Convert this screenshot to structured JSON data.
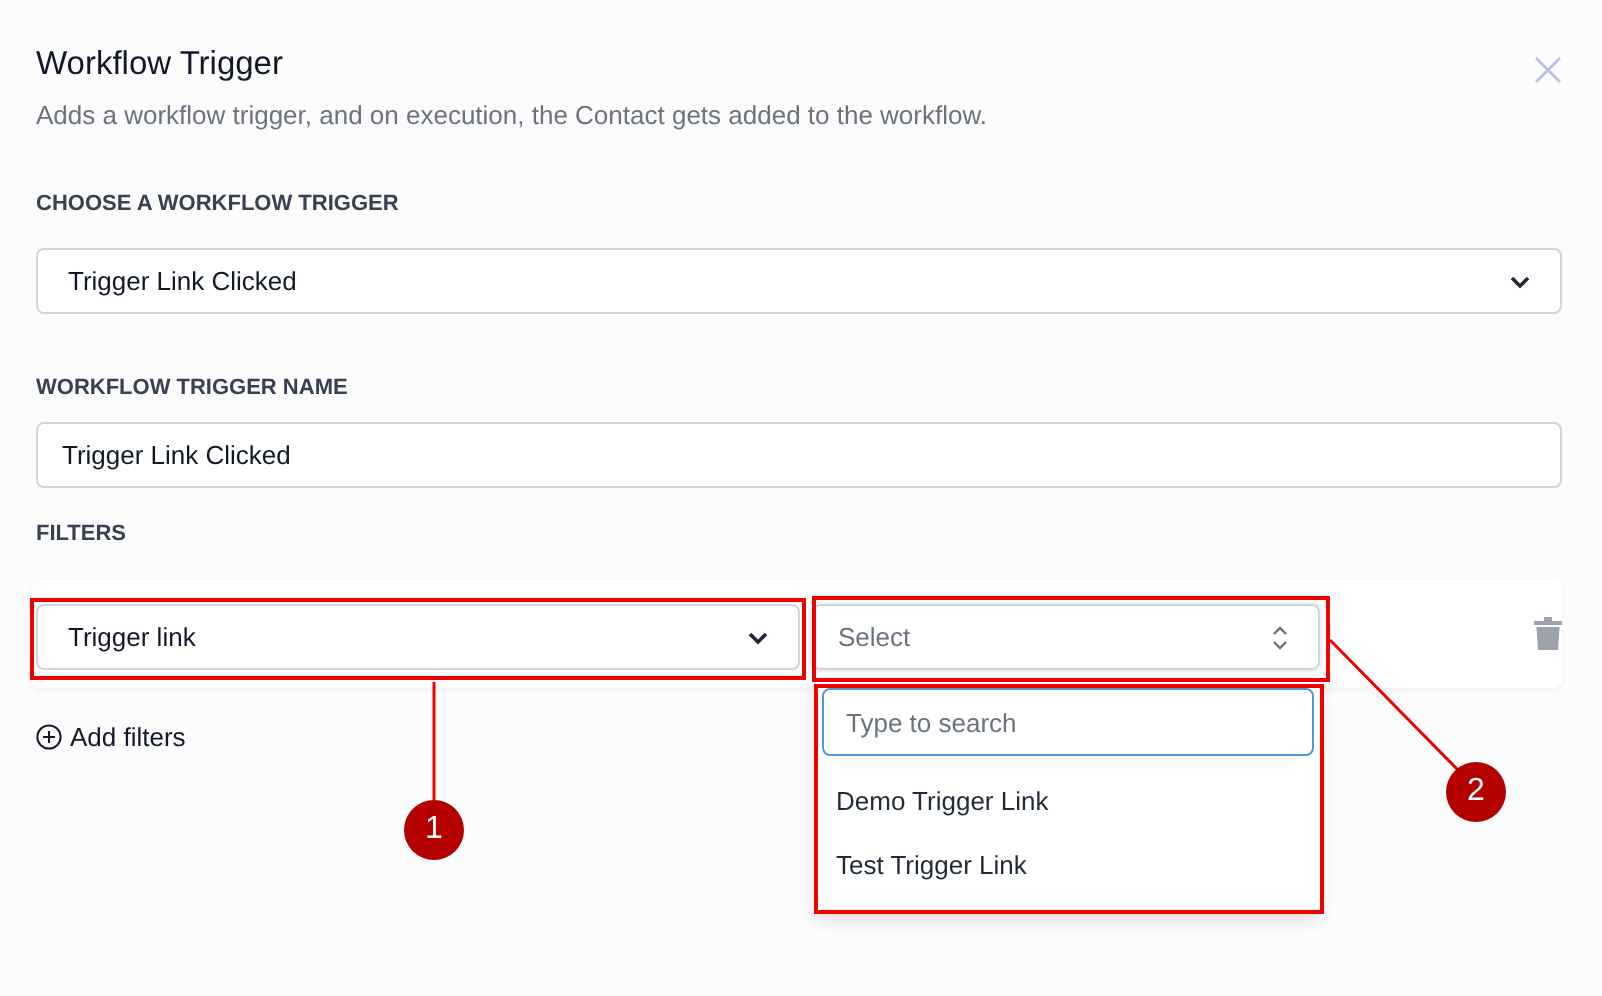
{
  "dialog": {
    "title": "Workflow Trigger",
    "subtitle": "Adds a workflow trigger, and on execution, the Contact gets added to the workflow."
  },
  "trigger_select": {
    "label": "CHOOSE A WORKFLOW TRIGGER",
    "value": "Trigger Link Clicked"
  },
  "trigger_name": {
    "label": "WORKFLOW TRIGGER NAME",
    "value": "Trigger Link Clicked"
  },
  "filters": {
    "label": "FILTERS",
    "field": {
      "value": "Trigger link"
    },
    "operand": {
      "placeholder": "Select",
      "expanded": true,
      "search_placeholder": "Type to search",
      "options": [
        "Demo Trigger Link",
        "Test Trigger Link"
      ]
    },
    "add_button": "Add filters"
  },
  "callouts": [
    {
      "number": "1"
    },
    {
      "number": "2"
    }
  ]
}
